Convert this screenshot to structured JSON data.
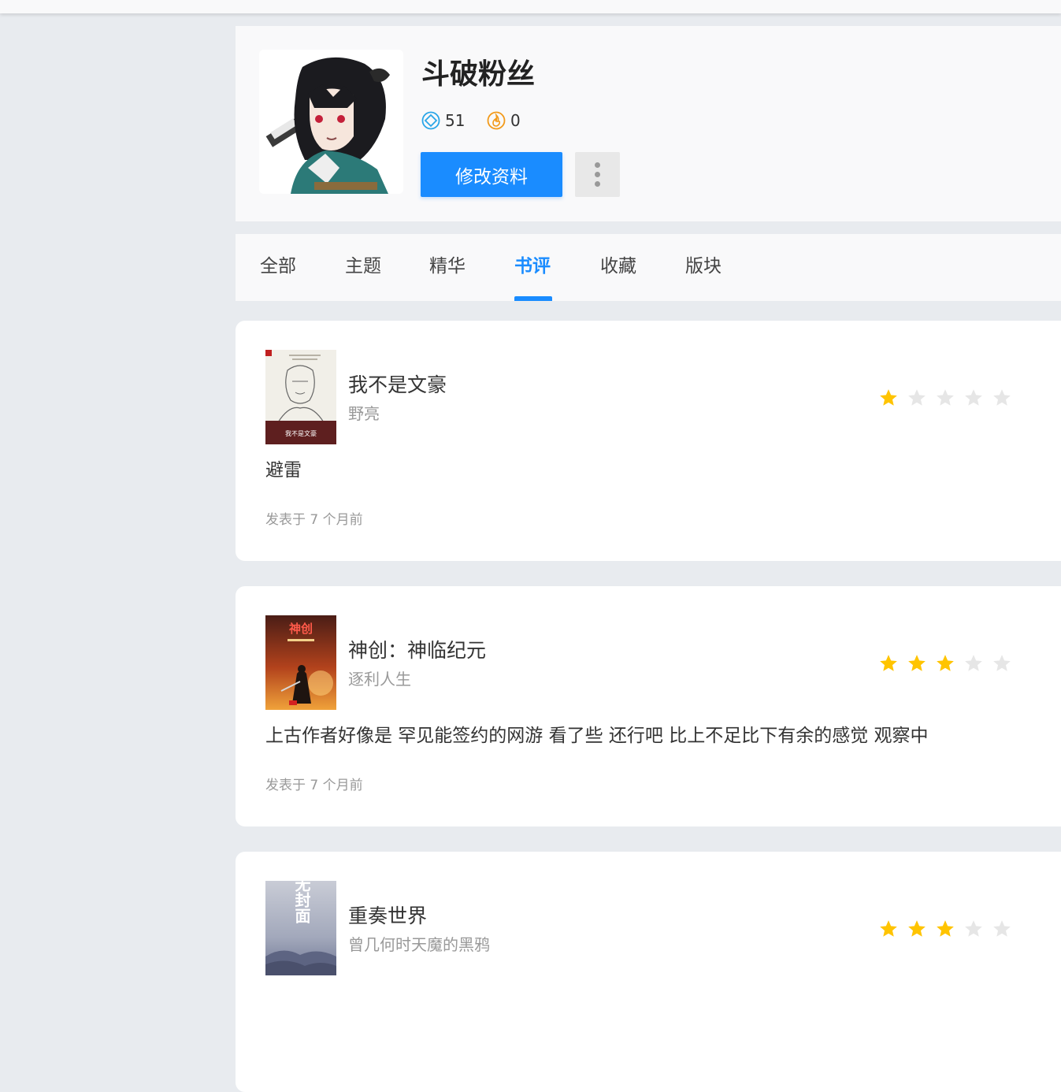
{
  "user": {
    "name": "斗破粉丝",
    "stat_diamond": "51",
    "stat_energy": "0",
    "edit_button": "修改资料"
  },
  "tabs": [
    {
      "label": "全部",
      "active": false
    },
    {
      "label": "主题",
      "active": false
    },
    {
      "label": "精华",
      "active": false
    },
    {
      "label": "书评",
      "active": true
    },
    {
      "label": "收藏",
      "active": false
    },
    {
      "label": "版块",
      "active": false
    }
  ],
  "reviews": [
    {
      "title": "我不是文豪",
      "author": "野亮",
      "rating": 1,
      "text": "避雷",
      "time": "发表于 7 个月前",
      "cover_text": "我不是文豪"
    },
    {
      "title": "神创：神临纪元",
      "author": "逐利人生",
      "rating": 3,
      "text": "上古作者好像是 罕见能签约的网游 看了些 还行吧 比上不足比下有余的感觉 观察中",
      "time": "发表于 7 个月前",
      "cover_text": "神创"
    },
    {
      "title": "重奏世界",
      "author": "曾几何时天魔的黑鸦",
      "rating": 3,
      "text": "",
      "time": "",
      "cover_text": "暂无封面"
    }
  ],
  "colors": {
    "accent": "#1a8cff",
    "star_on": "#ffc400",
    "star_off": "#e6e6e6"
  }
}
